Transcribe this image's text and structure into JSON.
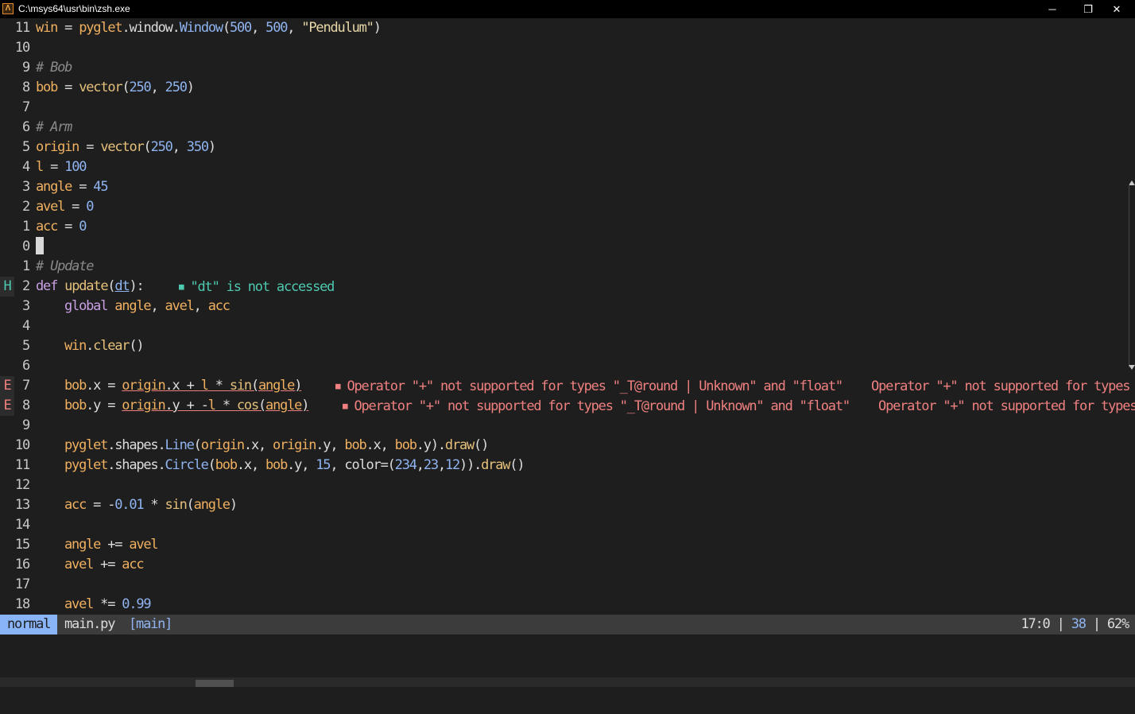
{
  "window": {
    "title": "C:\\msys64\\usr\\bin\\zsh.exe",
    "minimize": "─",
    "restore": "❐",
    "close": "✕"
  },
  "editor": {
    "lines": {
      "l0": "11",
      "l1": "10",
      "l2": "9",
      "l3": "8",
      "l4": "7",
      "l5": "6",
      "l6": "5",
      "l7": "4",
      "l8": "3",
      "l9": "2",
      "l10": "1",
      "l11": "0",
      "l12": "1",
      "l13": "2",
      "l14": "3",
      "l15": "4",
      "l16": "5",
      "l17": "6",
      "l18": "7",
      "l19": "8",
      "l20": "9",
      "l21": "10",
      "l22": "11",
      "l23": "12",
      "l24": "13",
      "l25": "14",
      "l26": "15",
      "l27": "16",
      "l28": "17",
      "l29": "18"
    },
    "signs": {
      "hint": "H",
      "err1": "E",
      "err2": "E"
    },
    "code": {
      "c0_a": "win",
      "c0_b": " = ",
      "c0_c": "pyglet",
      "c0_d": ".window.",
      "c0_e": "Window",
      "c0_f": "(",
      "c0_g": "500",
      "c0_h": ", ",
      "c0_i": "500",
      "c0_j": ", ",
      "c0_k": "\"Pendulum\"",
      "c0_l": ")",
      "c2": "# Bob",
      "c3_a": "bob",
      "c3_b": " = ",
      "c3_c": "vector",
      "c3_d": "(",
      "c3_e": "250",
      "c3_f": ", ",
      "c3_g": "250",
      "c3_h": ")",
      "c5": "# Arm",
      "c6_a": "origin",
      "c6_b": " = ",
      "c6_c": "vector",
      "c6_d": "(",
      "c6_e": "250",
      "c6_f": ", ",
      "c6_g": "350",
      "c6_h": ")",
      "c7_a": "l",
      "c7_b": " = ",
      "c7_c": "100",
      "c8_a": "angle",
      "c8_b": " = ",
      "c8_c": "45",
      "c9_a": "avel",
      "c9_b": " = ",
      "c9_c": "0",
      "c10_a": "acc",
      "c10_b": " = ",
      "c10_c": "0",
      "c12": "# Update",
      "c13_a": "def",
      "c13_b": " ",
      "c13_c": "update",
      "c13_d": "(",
      "c13_e": "dt",
      "c13_f": "):",
      "c13_diag_icon": "■",
      "c13_diag": "\"dt\" is not accessed",
      "c14_a": "global",
      "c14_b": " angle",
      "c14_c": ", ",
      "c14_d": "avel",
      "c14_e": ", ",
      "c14_f": "acc",
      "c16_a": "win",
      "c16_b": ".",
      "c16_c": "clear",
      "c16_d": "()",
      "c18_a": "bob",
      "c18_b": ".x = ",
      "c18_c": "origin",
      "c18_d": ".x + ",
      "c18_e": "l",
      "c18_f": " * ",
      "c18_g": "sin",
      "c18_h": "(",
      "c18_i": "angle",
      "c18_j": ")",
      "c18_diag_icon": "■",
      "c18_diag": "Operator \"+\" not supported for types \"_T@round | Unknown\" and \"float\"    Operator \"+\" not supported for types \"_T@round | Unknown\" and \"float\"",
      "c19_a": "bob",
      "c19_b": ".y = ",
      "c19_c": "origin",
      "c19_d": ".y + -",
      "c19_e": "l",
      "c19_f": " * ",
      "c19_g": "cos",
      "c19_h": "(",
      "c19_i": "angle",
      "c19_j": ")",
      "c19_diag_icon": "■",
      "c19_diag": "Operator \"+\" not supported for types \"_T@round | Unknown\" and \"float\"    Operator \"+\" not supported for types \"_T@round | Unknown\" and \"float\"",
      "c21_a": "pyglet",
      "c21_b": ".shapes.",
      "c21_c": "Line",
      "c21_d": "(",
      "c21_e": "origin",
      "c21_f": ".x, ",
      "c21_g": "origin",
      "c21_h": ".y, ",
      "c21_i": "bob",
      "c21_j": ".x, ",
      "c21_k": "bob",
      "c21_l": ".y).",
      "c21_m": "draw",
      "c21_n": "()",
      "c22_a": "pyglet",
      "c22_b": ".shapes.",
      "c22_c": "Circle",
      "c22_d": "(",
      "c22_e": "bob",
      "c22_f": ".x, ",
      "c22_g": "bob",
      "c22_h": ".y, ",
      "c22_i": "15",
      "c22_j": ", color=(",
      "c22_k": "234",
      "c22_l": ",",
      "c22_m": "23",
      "c22_n": ",",
      "c22_o": "12",
      "c22_p": ")).",
      "c22_q": "draw",
      "c22_r": "()",
      "c24_a": "acc",
      "c24_b": " = -",
      "c24_c": "0.01",
      "c24_d": " * ",
      "c24_e": "sin",
      "c24_f": "(",
      "c24_g": "angle",
      "c24_h": ")",
      "c26_a": "angle",
      "c26_b": " += ",
      "c26_c": "avel",
      "c27_a": "avel",
      "c27_b": " += ",
      "c27_c": "acc",
      "c29_a": "avel",
      "c29_b": " *= ",
      "c29_c": "0.99"
    }
  },
  "status": {
    "mode": "normal",
    "file": "main.py",
    "branch": "[main]",
    "position": "17:0",
    "sep1": " | ",
    "count": "38",
    "sep2": " | ",
    "percent": "62%"
  }
}
